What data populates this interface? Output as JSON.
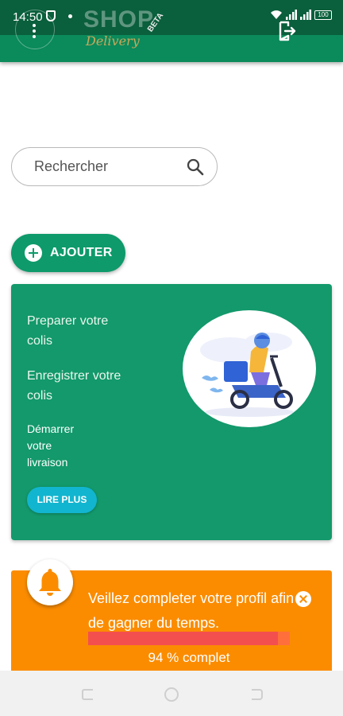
{
  "status_bar": {
    "time": "14:50",
    "battery": "100",
    "icons": [
      "shield-icon",
      "notification-dot",
      "wifi-icon",
      "signal-icon",
      "signal-icon",
      "battery-icon"
    ]
  },
  "app_bar": {
    "logo_shop": "SHOP",
    "logo_delivery": "Delivery",
    "logo_beta": "BETA",
    "menu_icon": "more-vert-icon",
    "logout_icon": "logout-icon"
  },
  "search": {
    "placeholder": "Rechercher",
    "icon": "search-icon"
  },
  "add_button": {
    "label": "AJOUTER",
    "icon": "add-circle-icon"
  },
  "info_card": {
    "steps": [
      "Preparer votre colis",
      "Enregistrer votre colis",
      "Démarrer votre livraison"
    ],
    "read_more_label": "LIRE PLUS",
    "illustration": "delivery-scooter-illustration"
  },
  "profile_banner": {
    "message": "Veillez completer votre profil afin de gagner du temps.",
    "progress_percent": 94,
    "progress_label": "94 % complet",
    "icon": "bell-icon",
    "close_icon": "close-icon"
  },
  "nav_bar": {
    "buttons": [
      "recent-apps-icon",
      "home-icon",
      "back-icon"
    ]
  },
  "colors": {
    "primary": "#0b8a5b",
    "card": "#13996b",
    "accent_cyan": "#12b5cf",
    "banner": "#fb8c00",
    "progress": "#f44f4f"
  }
}
